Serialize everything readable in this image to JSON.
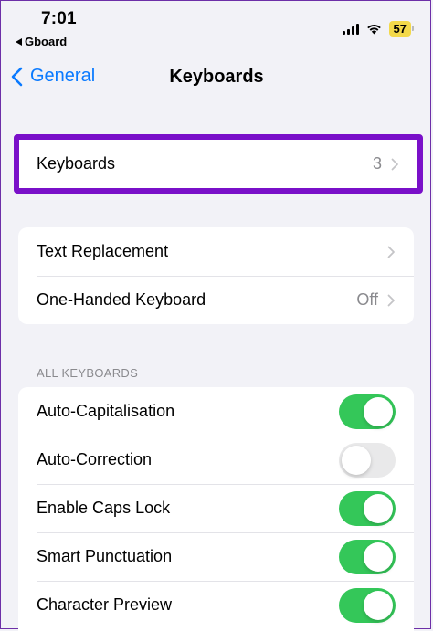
{
  "status_bar": {
    "time": "7:01",
    "back_app": "Gboard",
    "battery": "57"
  },
  "nav": {
    "back_label": "General",
    "title": "Keyboards"
  },
  "keyboards_row": {
    "label": "Keyboards",
    "value": "3"
  },
  "group2": {
    "items": [
      {
        "label": "Text Replacement",
        "value": ""
      },
      {
        "label": "One-Handed Keyboard",
        "value": "Off"
      }
    ]
  },
  "all_keyboards": {
    "header": "ALL KEYBOARDS",
    "items": [
      {
        "label": "Auto-Capitalisation",
        "on": true
      },
      {
        "label": "Auto-Correction",
        "on": false
      },
      {
        "label": "Enable Caps Lock",
        "on": true
      },
      {
        "label": "Smart Punctuation",
        "on": true
      },
      {
        "label": "Character Preview",
        "on": true
      }
    ]
  },
  "colors": {
    "accent": "#0a7aff",
    "toggle_on": "#34c759",
    "highlight_border": "#7a10c9"
  }
}
